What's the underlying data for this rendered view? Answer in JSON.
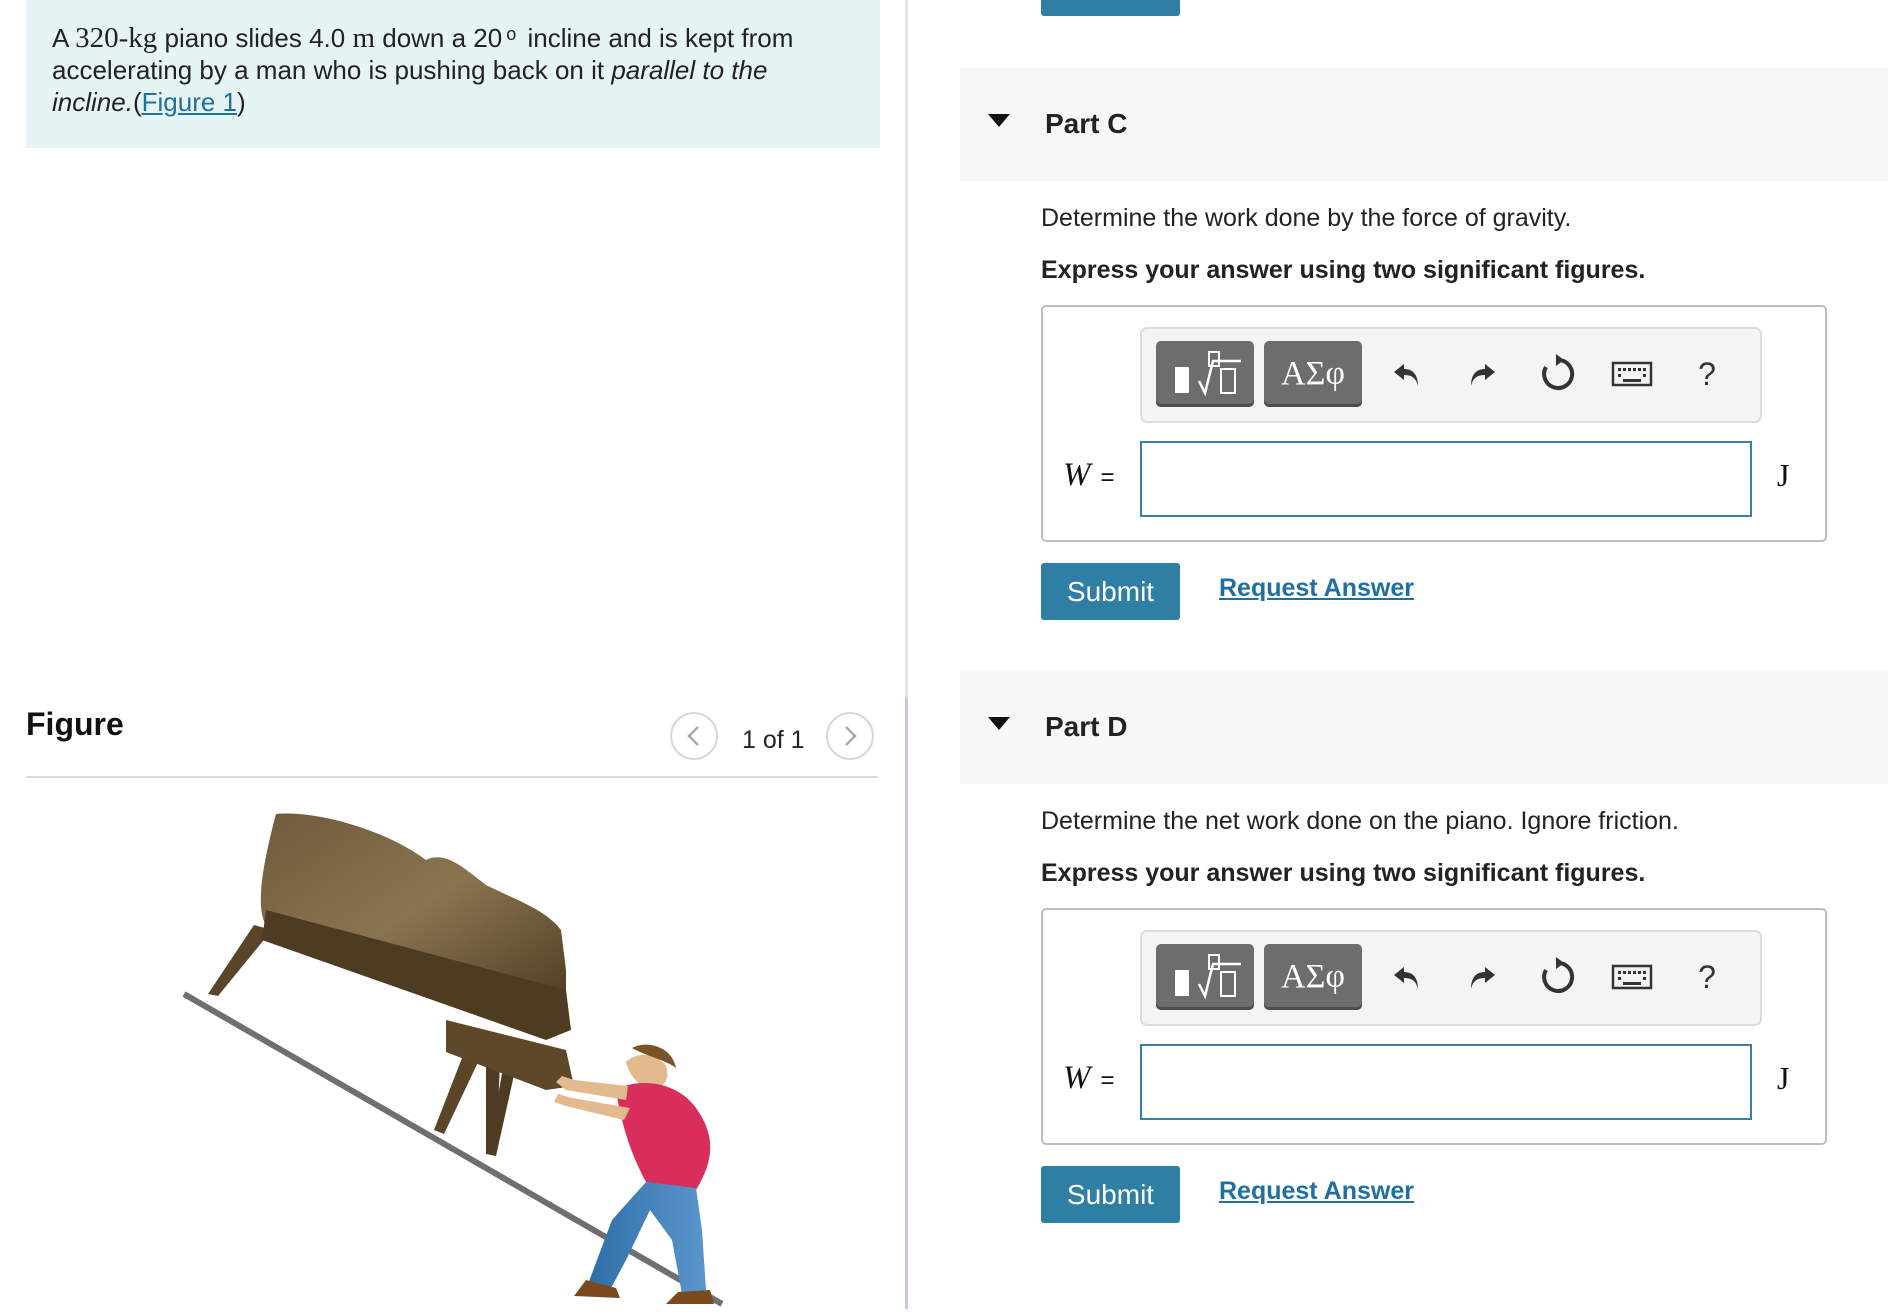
{
  "problem": {
    "prefix": "A ",
    "mass": "320-kg",
    "text1": " piano slides 4.0 ",
    "dist_unit": "m",
    "text2": " down a 20",
    "degree": "o",
    "text3": " incline and is kept from accelerating by a man who is pushing back on it ",
    "italic": "parallel to the incline.",
    "open_paren": "(",
    "figure_link": "Figure 1",
    "close_paren": ")"
  },
  "figure": {
    "title": "Figure",
    "pager": "1 of 1",
    "prev_icon": "chevron-left-icon",
    "next_icon": "chevron-right-icon"
  },
  "parts": [
    {
      "title": "Part C",
      "question": "Determine the work done by the force of gravity.",
      "instruction": "Express your answer using two significant figures.",
      "variable": "W",
      "equals": "=",
      "unit": "J",
      "answer_value": "",
      "submit_label": "Submit",
      "request_label": "Request Answer"
    },
    {
      "title": "Part D",
      "question": "Determine the net work done on the piano. Ignore friction.",
      "instruction": "Express your answer using two significant figures.",
      "variable": "W",
      "equals": "=",
      "unit": "J",
      "answer_value": "",
      "submit_label": "Submit",
      "request_label": "Request Answer"
    }
  ],
  "toolbar": {
    "greek_label": "ΑΣφ",
    "help_label": "?",
    "icons": [
      "templates-icon",
      "greek-symbols-icon",
      "undo-icon",
      "redo-icon",
      "reset-icon",
      "keyboard-icon",
      "help-icon"
    ]
  },
  "colors": {
    "accent": "#2e7fa3",
    "link": "#1f6fa0",
    "problem_bg": "#e6f5f4",
    "part_header_bg": "#f7f7f7"
  }
}
